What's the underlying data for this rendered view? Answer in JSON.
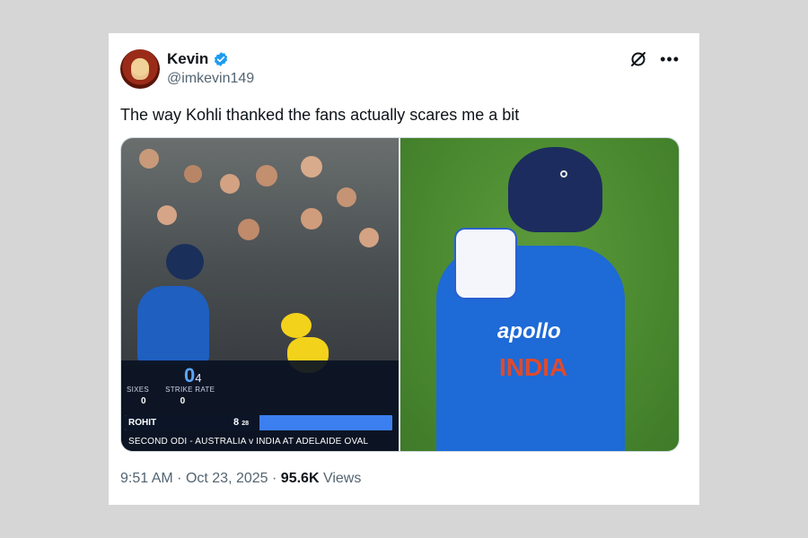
{
  "tweet": {
    "display_name": "Kevin",
    "handle": "@imkevin149",
    "text": "The way Kohli thanked the fans actually scares me a bit",
    "time": "9:51 AM",
    "separator_1": "·",
    "date": "Oct 23, 2025",
    "separator_2": "·",
    "views_count": "95.6K",
    "views_label": "Views"
  },
  "icons": {
    "verified": "verified-badge-icon",
    "grok": "grok-icon",
    "more": "more-options-icon"
  },
  "scorecard": {
    "runs": "0",
    "balls": "4",
    "col1_label": "SIXES",
    "col2_label": "STRIKE RATE",
    "col1_value": "0",
    "col2_value": "0",
    "batter_name": "ROHIT",
    "batter_runs": "8",
    "batter_balls": "28",
    "match_line": "SECOND ODI - AUSTRALIA v INDIA AT ADELAIDE OVAL"
  },
  "jersey": {
    "sponsor": "apollo",
    "country": "INDIA"
  },
  "colors": {
    "verified_blue": "#1d9bf0",
    "text_primary": "#0f1419",
    "text_secondary": "#536471",
    "background": "#d6d6d6",
    "card": "#ffffff"
  }
}
